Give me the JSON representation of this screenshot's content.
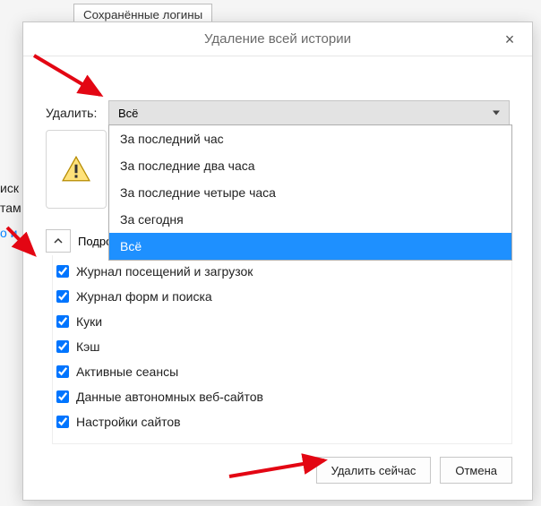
{
  "background": {
    "saved_logins_button": "Сохранённые логины",
    "left_fragment_1": "иск",
    "left_fragment_2": "там",
    "left_fragment_3": "о и"
  },
  "dialog": {
    "title": "Удаление всей истории",
    "delete_label": "Удалить:",
    "select_value": "Всё",
    "details_label": "Подробности",
    "options": [
      "За последний час",
      "За последние два часа",
      "За последние четыре часа",
      "За сегодня",
      "Всё"
    ],
    "selected_index": 4,
    "checks": [
      {
        "label": "Журнал посещений и загрузок",
        "checked": true
      },
      {
        "label": "Журнал форм и поиска",
        "checked": true
      },
      {
        "label": "Куки",
        "checked": true
      },
      {
        "label": "Кэш",
        "checked": true
      },
      {
        "label": "Активные сеансы",
        "checked": true
      },
      {
        "label": "Данные автономных веб-сайтов",
        "checked": true
      },
      {
        "label": "Настройки сайтов",
        "checked": true
      }
    ],
    "buttons": {
      "ok": "Удалить сейчас",
      "cancel": "Отмена"
    }
  }
}
